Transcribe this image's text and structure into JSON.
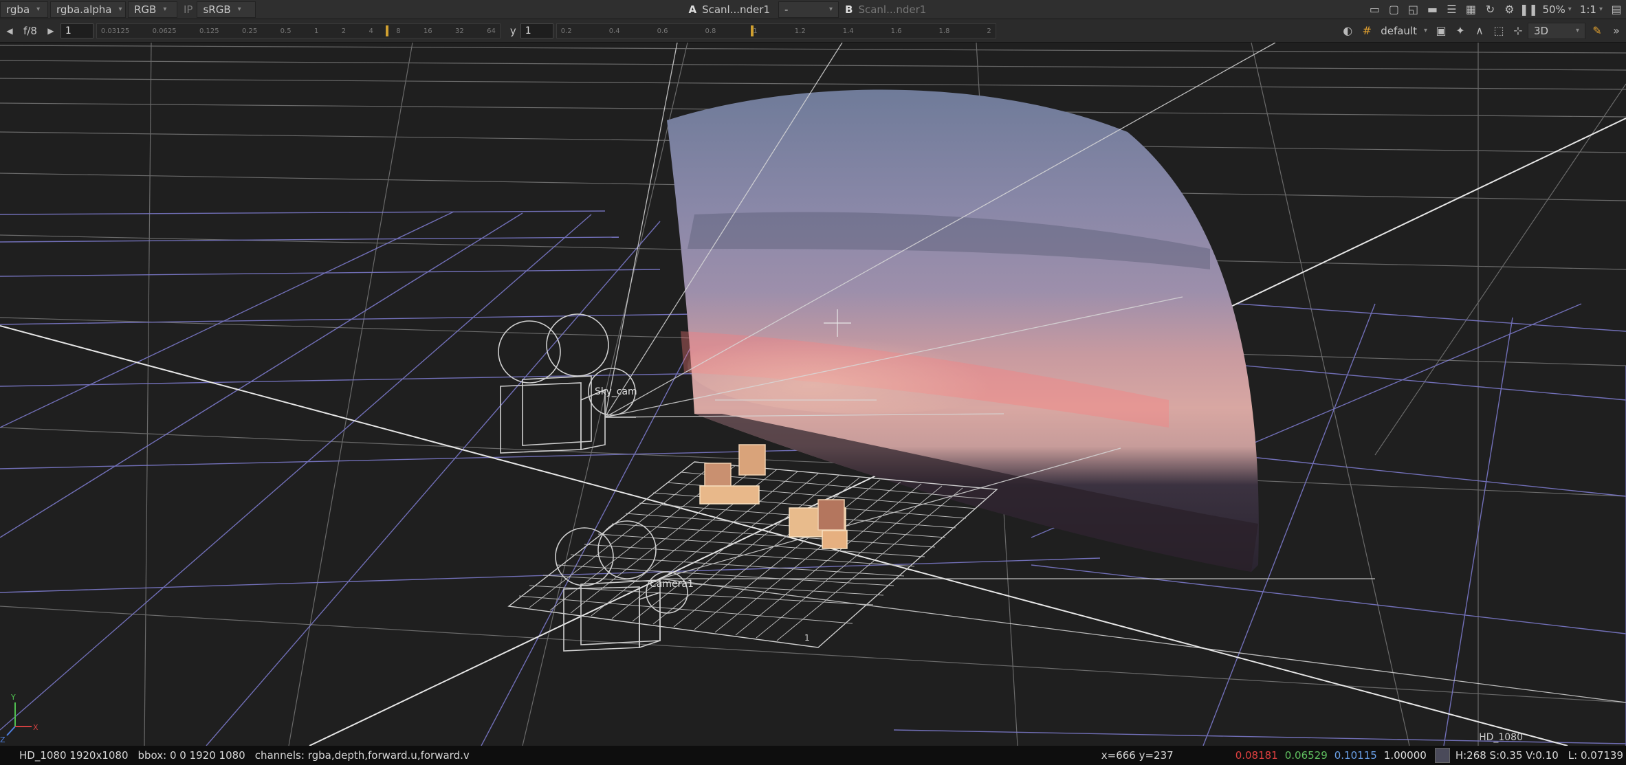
{
  "toolbar_top": {
    "channels": "rgba",
    "alpha_channel": "rgba.alpha",
    "display_channels": "RGB",
    "ip_label": "IP",
    "colorspace": "sRGB",
    "input_a_label": "A",
    "input_a_value": "Scanl...nder1",
    "wipe_value": "-",
    "input_b_label": "B",
    "input_b_value": "Scanl...nder1",
    "zoom": "50%",
    "proxy": "1:1"
  },
  "toolbar_second": {
    "fstop": "f/8",
    "frame": "1",
    "gain_ticks": [
      "0.03125",
      "0.0625",
      "0.125",
      "0.25",
      "0.5",
      "1",
      "2",
      "4",
      "8",
      "16",
      "32",
      "64"
    ],
    "gamma_label": "y",
    "gamma_value": "1",
    "gamma_ticks": [
      "0.2",
      "0.4",
      "0.6",
      "0.8",
      "1",
      "1.2",
      "1.4",
      "1.6",
      "1.8",
      "2"
    ],
    "viewer_lut": "default",
    "view_mode": "3D"
  },
  "viewport": {
    "camera_labels": [
      "Sky_cam",
      "Camera1"
    ],
    "format_label": "HD_1080",
    "grid_small_label": "1",
    "gizmo_axes": [
      "Y",
      "Z",
      "X"
    ]
  },
  "statusbar": {
    "format": "HD_1080 1920x1080",
    "bbox": "bbox: 0 0 1920 1080",
    "channels": "channels: rgba,depth,forward.u,forward.v",
    "coords": "x=666 y=237",
    "r": "0.08181",
    "g": "0.06529",
    "b": "0.10115",
    "a": "1.00000",
    "hsv": "H:268 S:0.35 V:0.10",
    "luma": "L: 0.07139",
    "colors": {
      "r": "#e04040",
      "g": "#60c060",
      "b": "#6aa0e8",
      "a": "#e0e0e0"
    }
  }
}
